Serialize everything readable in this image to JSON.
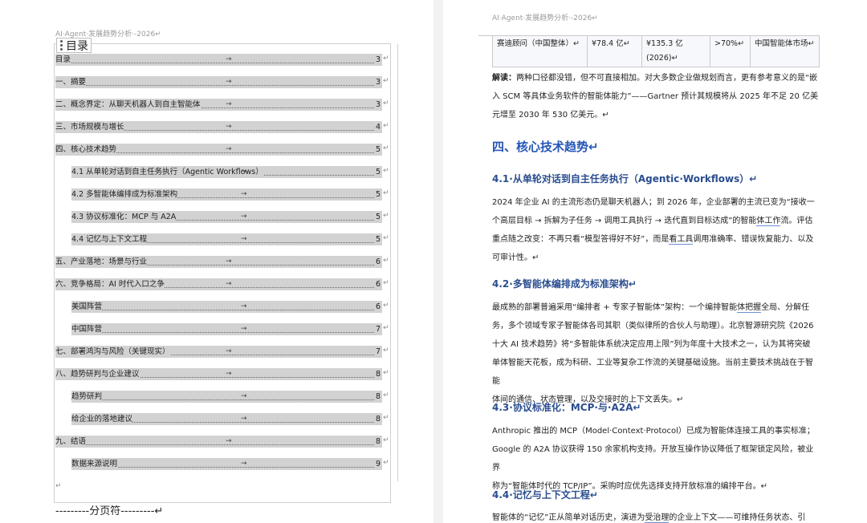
{
  "header": {
    "left": "AI·Agent·发展趋势分析·-2026↵",
    "right": "AI·Agent·发展趋势分析·-2026↵"
  },
  "toc": {
    "title": "目录",
    "items": [
      {
        "label": "目录",
        "page": "3",
        "indent": false
      },
      {
        "label": "一、摘要",
        "page": "3",
        "indent": false
      },
      {
        "label": "二、概念界定：从聊天机器人到自主智能体",
        "page": "3",
        "indent": false
      },
      {
        "label": "三、市场规模与增长",
        "page": "4",
        "indent": false
      },
      {
        "label": "四、核心技术趋势",
        "page": "5",
        "indent": false
      },
      {
        "label": "4.1 从单轮对话到自主任务执行（Agentic Workflows）",
        "page": "5",
        "indent": true
      },
      {
        "label": "4.2 多智能体编排成为标准架构",
        "page": "5",
        "indent": true
      },
      {
        "label": "4.3 协议标准化：MCP 与 A2A",
        "page": "5",
        "indent": true
      },
      {
        "label": "4.4 记忆与上下文工程",
        "page": "5",
        "indent": true
      },
      {
        "label": "五、产业落地：场景与行业",
        "page": "6",
        "indent": false
      },
      {
        "label": "六、竞争格局：AI 时代入口之争",
        "page": "6",
        "indent": false
      },
      {
        "label": "美国阵营",
        "page": "6",
        "indent": true
      },
      {
        "label": "中国阵营",
        "page": "7",
        "indent": true
      },
      {
        "label": "七、部署鸿沟与风险（关键现实）",
        "page": "7",
        "indent": false
      },
      {
        "label": "八、趋势研判与企业建议",
        "page": "8",
        "indent": false
      },
      {
        "label": "趋势研判",
        "page": "8",
        "indent": true
      },
      {
        "label": "给企业的落地建议",
        "page": "8",
        "indent": true
      },
      {
        "label": "九、结语",
        "page": "8",
        "indent": false
      },
      {
        "label": "数据来源说明",
        "page": "9",
        "indent": true
      }
    ],
    "return_mark": "↵",
    "page_break": "---------分页符---------↵"
  },
  "table_row": {
    "c1": "赛迪顾问（中国整体）↵",
    "c2": "¥78.4 亿↵",
    "c3a": "¥135.3 亿",
    "c3b": "(2026)↵",
    "c4": ">70%↵",
    "c5": "中国智能体市场↵"
  },
  "body": {
    "interp_label": "解读：",
    "interp_l1": "两种口径都没错，但不可直接相加。对大多数企业做规划而言，更有参考意义的是“嵌",
    "interp_l2": "入 SCM 等具体业务软件的智能体能力”——Gartner 预计其规模将从 2025 年不足 20 亿美",
    "interp_l3": "元增至 2030 年 530 亿美元。↵",
    "h_section4": "四、核心技术趋势↵",
    "h41": "4.1·从单轮对话到自主任务执行（Agentic·Workflows）↵",
    "p41_l1": "2024 年企业 AI 的主流形态仍是聊天机器人；到 2026 年，企业部署的主流已变为“接收一",
    "p41_l2a": "个高层目标 → 拆解为子任务 → 调用工具执行 → 迭代直到目标达成”的智能",
    "p41_l2u": "体工作",
    "p41_l2b": "流。评估",
    "p41_l3a": "重点随之改变：不再只看“模型答得好不好”，而是",
    "p41_l3u": "看工具",
    "p41_l3b": "调用准确率、错误恢复能力、以及",
    "p41_l4": "可审计性。↵",
    "h42": "4.2·多智能体编排成为标准架构↵",
    "p42_l1a": "最成熟的部署普遍采用“编排者 + 专家子智能体”架构：一个编排智能",
    "p42_l1u": "体把握",
    "p42_l1b": "全局、分解任",
    "p42_l2": "务，多个领域专家子智能体各司其职（类似律所的合伙人与助理）。北京智源研究院《2026",
    "p42_l3": "十大 AI 技术趋势》将“多智能体系统决定应用上限”列为年度十大技术之一，认为其将突破",
    "p42_l4": "单体智能天花板，成为科研、工业等复杂工作流的关键基础设施。当前主要技术挑战在于智能",
    "p42_l5": "体间的通信、状态管理，以及交接时的上下文丢失。↵",
    "h43": "4.3·协议标准化：MCP·与·A2A↵",
    "p43_l1": "Anthropic 推出的 MCP（Model·Context·Protocol）已成为智能体连接工具的事实标准；",
    "p43_l2": "Google 的 A2A 协议获得 150 余家机构支持。开放互操作协议降低了框架锁定风险，被业界",
    "p43_l3": "称为“智能体时代的 TCP/IP”。采购时应优先选择支持开放标准的编排平台。↵",
    "h44": "4.4·记忆与上下文工程↵",
    "p44_l1a": "智能体的“记忆”正从简单对话历史，演进为",
    "p44_l1u": "受治理",
    "p44_l1b": "的企业上下文——可维持任务状态、引"
  }
}
